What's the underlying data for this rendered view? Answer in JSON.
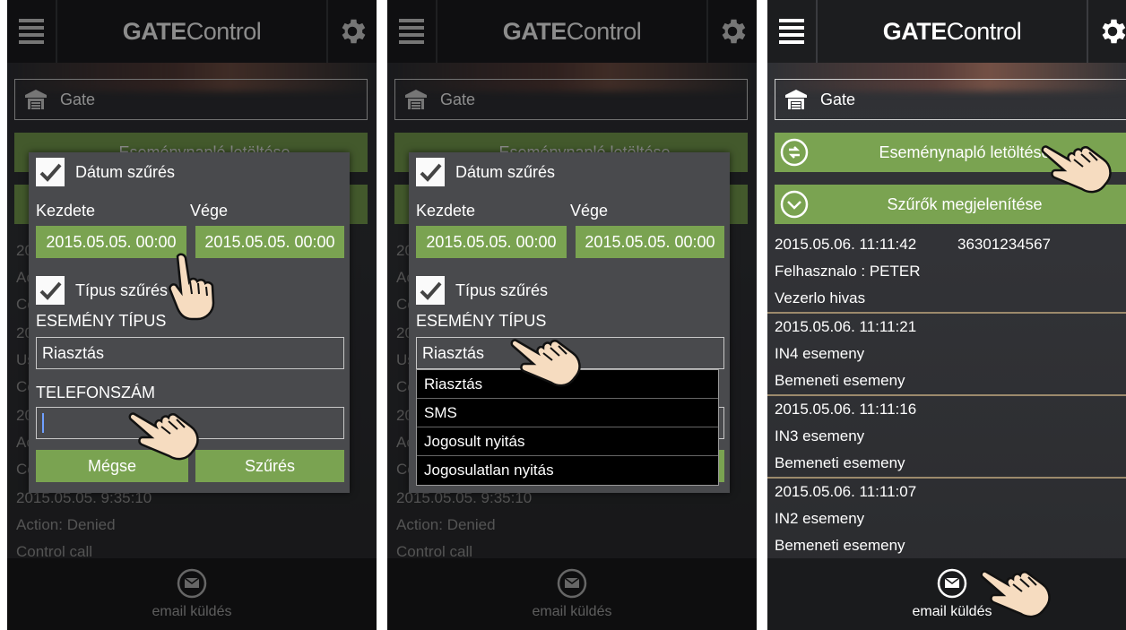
{
  "app": {
    "title_bold": "GATE",
    "title_light": "Control"
  },
  "gate_selector": {
    "label": "Gate"
  },
  "buttons": {
    "download_log": "Eseménynapló letöltése",
    "show_filters": "Szűrők megjelenítése"
  },
  "bottom": {
    "email_label": "email küldés"
  },
  "filter_dialog": {
    "date_filter_label": "Dátum szűrés",
    "start_label": "Kezdete",
    "end_label": "Vége",
    "start_value": "2015.05.05. 00:00",
    "end_value": "2015.05.05. 00:00",
    "type_filter_label": "Típus szűrés",
    "event_type_label": "ESEMÉNY TÍPUS",
    "event_type_value": "Riasztás",
    "phone_label": "TELEFONSZÁM",
    "phone_value": "",
    "cancel_label": "Mégse",
    "filter_label": "Szűrés"
  },
  "event_type_options": [
    "Riasztás",
    "SMS",
    "Jogosult nyitás",
    "Jogosulatlan nyitás"
  ],
  "background_log": {
    "first_chars": [
      "20",
      "Ac",
      "Co",
      "20",
      "Us",
      "Co",
      "20",
      "Ac",
      "Co"
    ],
    "last_date": "2015.05.05. 9:35:10",
    "last_action": "Action: Denied",
    "last_type": "Control call"
  },
  "log_entries": [
    {
      "date": "2015.05.06. 11:11:42",
      "number": "36301234567",
      "line2": "Felhasznalo  : PETER",
      "line3": "Vezerlo hivas"
    },
    {
      "date": "2015.05.06. 11:11:21",
      "number": "",
      "line2": "IN4 esemeny",
      "line3": "Bemeneti esemeny"
    },
    {
      "date": "2015.05.06. 11:11:16",
      "number": "",
      "line2": "IN3 esemeny",
      "line3": "Bemeneti esemeny"
    },
    {
      "date": "2015.05.06. 11:11:07",
      "number": "",
      "line2": "IN2 esemeny",
      "line3": "Bemeneti esemeny"
    }
  ],
  "colors": {
    "accent_green": "#7aa351",
    "topbar": "#1c1d1f",
    "background": "#2e3034",
    "separator": "#9c8a6c"
  },
  "icons": [
    "menu-icon",
    "gear-icon",
    "garage-icon",
    "sync-icon",
    "chevron-down-circle-icon",
    "email-icon",
    "checkmark-icon",
    "pointing-hand-icon"
  ]
}
